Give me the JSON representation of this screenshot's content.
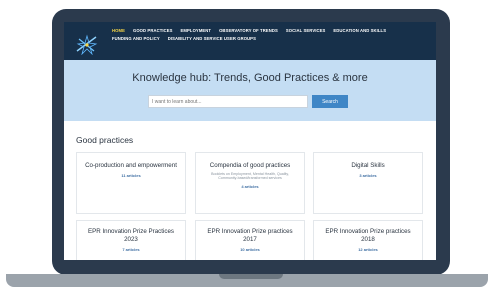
{
  "nav": {
    "row1": [
      "HOME",
      "GOOD PRACTICES",
      "EMPLOYMENT",
      "OBSERVATORY OF TRENDS",
      "SOCIAL SERVICES",
      "EDUCATION AND SKILLS"
    ],
    "row2": [
      "FUNDING AND POLICY",
      "DISABILITY AND SERVICE USER GROUPS"
    ],
    "active": "HOME",
    "active_color": "#f5d547"
  },
  "hero": {
    "title": "Knowledge hub: Trends, Good Practices & more",
    "search_placeholder": "I want to learn about...",
    "search_button": "Search"
  },
  "good_practices": {
    "heading": "Good practices",
    "cards": [
      {
        "title": "Co-production and empowerment",
        "description": "",
        "count": "11 articles"
      },
      {
        "title": "Compendia of good practices",
        "description": "Booklets on Employment, Mental Health, Quality, Community-based/transformed services",
        "count": "4 articles"
      },
      {
        "title": "Digital Skills",
        "description": "",
        "count": "3 articles"
      },
      {
        "title": "EPR Innovation Prize Practices 2023",
        "description": "",
        "count": "7 articles"
      },
      {
        "title": "EPR Innovation Prize practices 2017",
        "description": "",
        "count": "10 articles"
      },
      {
        "title": "EPR Innovation Prize practices 2018",
        "description": "",
        "count": "12 articles"
      }
    ]
  },
  "colors": {
    "header_bg": "#17304a",
    "hero_bg": "#c4ddf3",
    "button_bg": "#3f86c6",
    "laptop_frame": "#2b3a4d"
  }
}
